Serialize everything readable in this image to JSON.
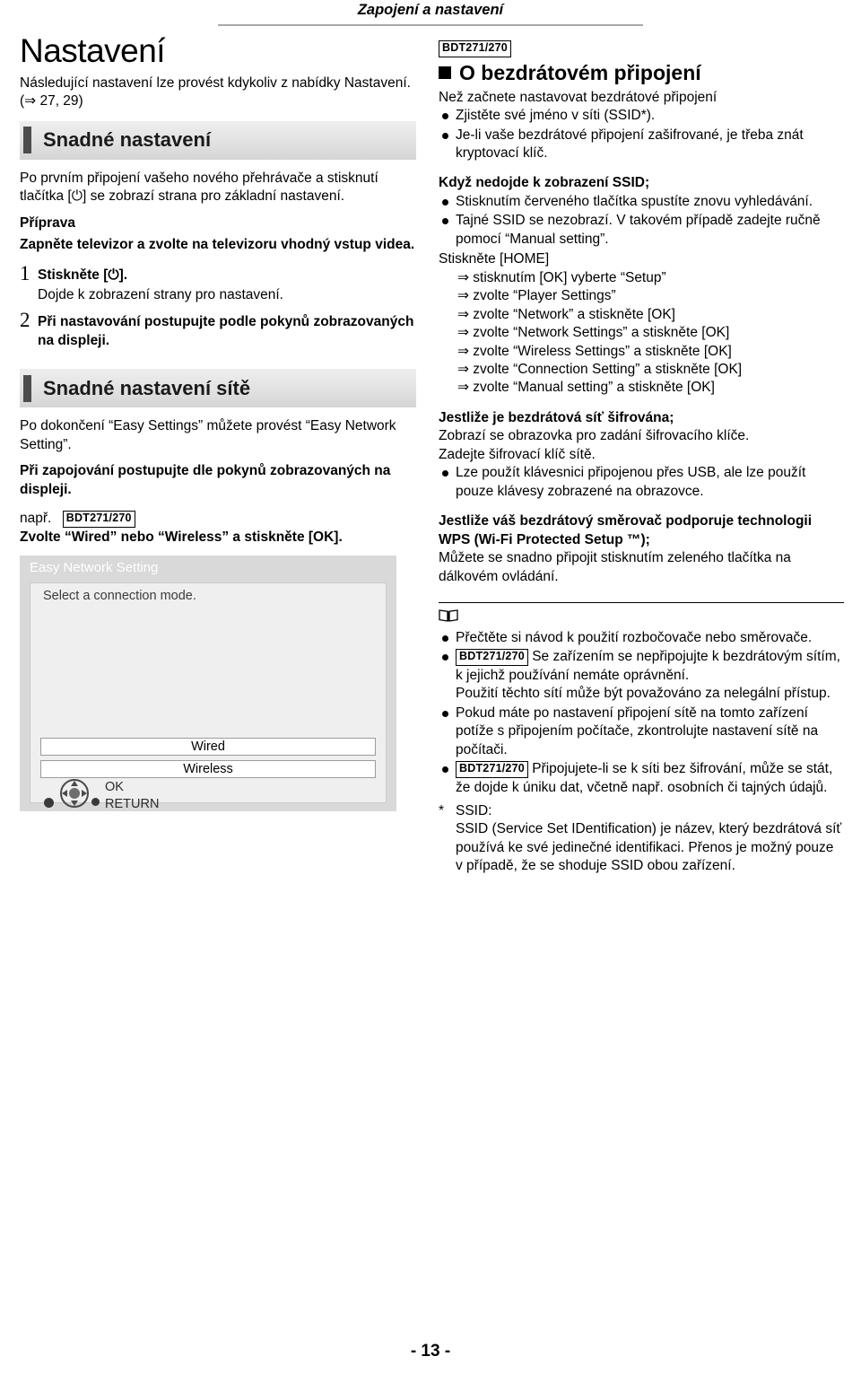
{
  "header": {
    "title": "Zapojení a nastavení"
  },
  "left": {
    "title": "Nastavení",
    "intro": "Následující nastavení lze provést kdykoliv z nabídky Nastavení. (⇒ 27, 29)",
    "section1_label": "Snadné nastavení",
    "para1": "Po prvním připojení vašeho nového přehrávače a stisknutí tlačítka [⏻] se zobrazí strana pro základní nastavení.",
    "prep_label": "Příprava",
    "prep_text": "Zapněte televizor a zvolte na televizoru vhodný vstup videa.",
    "step1_num": "1",
    "step1_text": "Stiskněte [⏻].",
    "step1_sub": "Dojde k zobrazení strany pro nastavení.",
    "step2_num": "2",
    "step2_text": "Při nastavování postupujte podle pokynů zobrazovaných na displeji.",
    "section2_label": "Snadné nastavení sítě",
    "para2": "Po dokončení “Easy Settings” můžete provést “Easy Network Setting”.",
    "para3": "Při zapojování postupujte dle pokynů zobrazovaných na displeji.",
    "eg_label": "např.",
    "eg_badge": "BDT271/270",
    "eg_text": "Zvolte “Wired” nebo “Wireless” a stiskněte [OK].",
    "tv": {
      "title": "Easy Network Setting",
      "subtitle": "Select a connection mode.",
      "option_wired": "Wired",
      "option_wireless": "Wireless",
      "ok_label": "OK",
      "return_label": "RETURN"
    }
  },
  "right": {
    "badge": "BDT271/270",
    "heading": "O bezdrátovém připojení",
    "intro": "Než začnete nastavovat bezdrátové připojení",
    "intro_bullets": [
      "Zjistěte své jméno v síti (SSID*).",
      "Je-li vaše bezdrátové připojení zašifrované, je třeba znát kryptovací klíč."
    ],
    "ssid_head": "Když nedojde k zobrazení SSID;",
    "ssid_bullets": [
      "Stisknutím červeného tlačítka spustíte znovu vyhledávání.",
      "Tajné SSID se nezobrazí. V takovém případě zadejte ručně pomocí “Manual setting”."
    ],
    "home_line": "Stiskněte [HOME]",
    "home_steps": [
      "⇒ stisknutím [OK] vyberte “Setup”",
      "⇒ zvolte “Player Settings”",
      "⇒ zvolte “Network” a stiskněte [OK]",
      "⇒ zvolte “Network Settings” a stiskněte [OK]",
      "⇒ zvolte “Wireless Settings” a stiskněte [OK]",
      "⇒ zvolte “Connection Setting” a stiskněte [OK]",
      "⇒ zvolte “Manual setting” a stiskněte [OK]"
    ],
    "enc_head": "Jestliže je bezdrátová síť šifrována;",
    "enc_lines": [
      "Zobrazí se obrazovka pro zadání šifrovacího klíče.",
      "Zadejte šifrovací klíč sítě."
    ],
    "enc_bullet": "Lze použít klávesnici připojenou přes USB, ale lze použít pouze klávesy zobrazené na obrazovce.",
    "wps_head": "Jestliže váš bezdrátový směrovač podporuje technologii WPS (Wi-Fi Protected Setup ™);",
    "wps_text": "Můžete se snadno připojit stisknutím zeleného tlačítka na dálkovém ovládání.",
    "notes": [
      {
        "text": "Přečtěte si návod k použití rozbočovače nebo směrovače."
      },
      {
        "badge": "BDT271/270",
        "text": "Se zařízením se nepřipojujte k bezdrátovým sítím, k jejichž používání nemáte oprávnění.",
        "sub": "Použití těchto sítí může být považováno za nelegální přístup."
      },
      {
        "text": "Pokud máte po nastavení připojení sítě na tomto zařízení potíže s připojením počítače, zkontrolujte nastavení sítě na počítači."
      },
      {
        "badge": "BDT271/270",
        "text": "Připojujete-li se k síti bez šifrování, může se stát, že dojde k úniku dat, včetně např. osobních či tajných údajů."
      }
    ],
    "footnote_star": "*",
    "footnote_label": "SSID:",
    "footnote_text": "SSID (Service Set IDentification) je název, který bezdrátová síť používá ke své jedinečné identifikaci. Přenos je možný pouze v případě, že se shoduje SSID obou zařízení."
  },
  "footer": {
    "page": "- 13 -"
  }
}
